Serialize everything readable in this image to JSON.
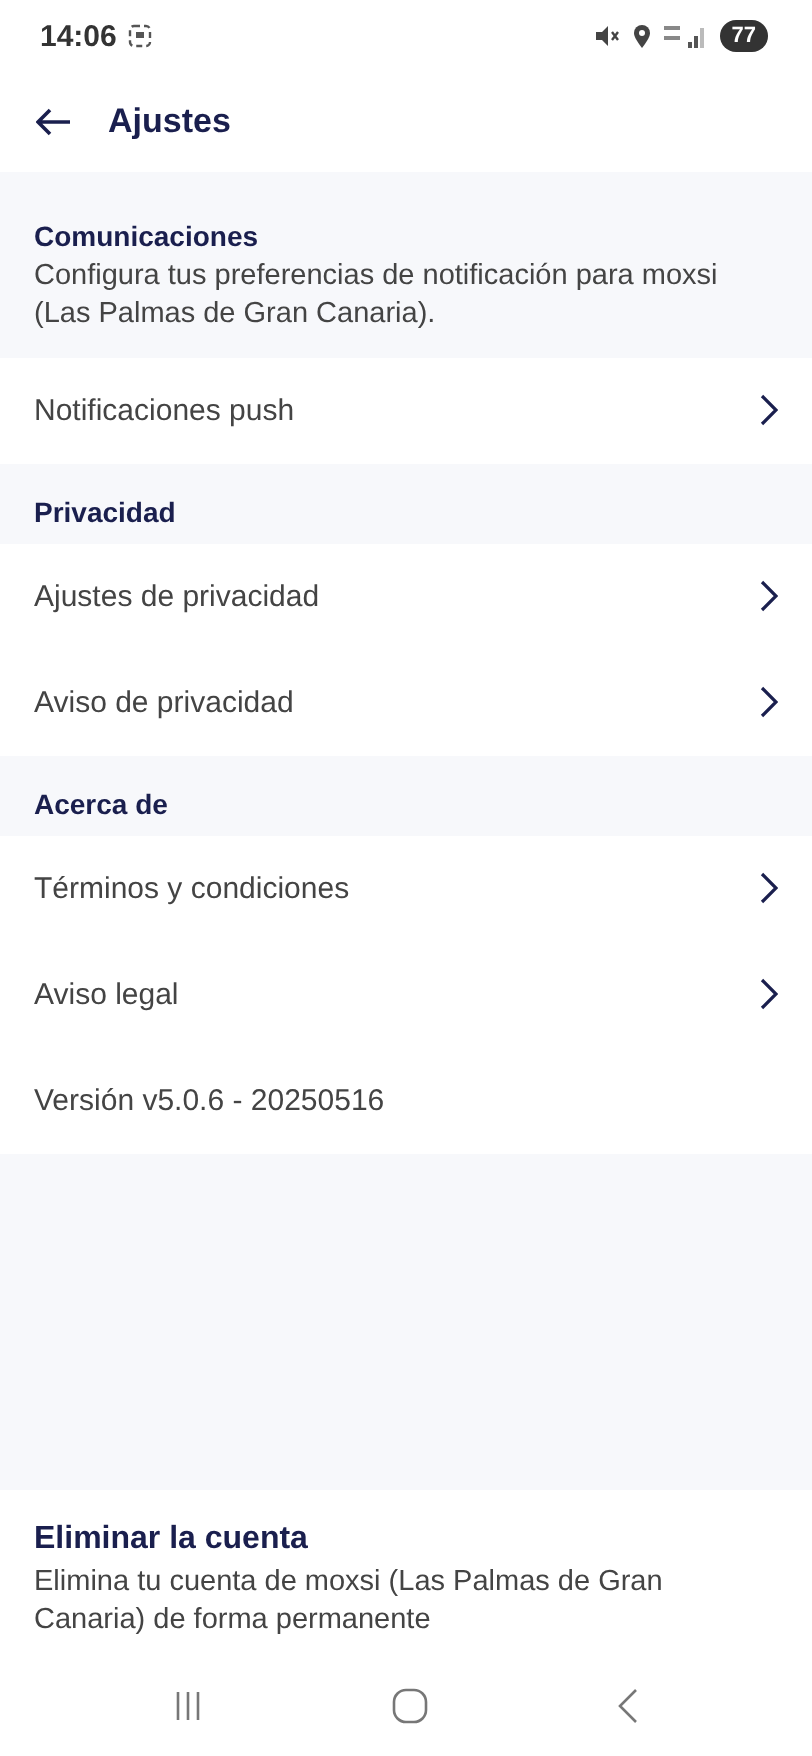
{
  "status_bar": {
    "time": "14:06",
    "battery": "77"
  },
  "header": {
    "title": "Ajustes"
  },
  "sections": [
    {
      "title": "Comunicaciones",
      "description": "Configura tus preferencias de notificación para moxsi (Las Palmas de Gran Canaria).",
      "items": [
        {
          "kind": "link",
          "label": "Notificaciones push"
        }
      ]
    },
    {
      "title": "Privacidad",
      "items": [
        {
          "kind": "link",
          "label": "Ajustes de privacidad"
        },
        {
          "kind": "link",
          "label": "Aviso de privacidad"
        }
      ]
    },
    {
      "title": "Acerca de",
      "items": [
        {
          "kind": "link",
          "label": "Términos y condiciones"
        },
        {
          "kind": "link",
          "label": "Aviso legal"
        },
        {
          "kind": "text",
          "label": "Versión v5.0.6 - 20250516"
        }
      ]
    }
  ],
  "delete_account": {
    "title": "Eliminar la cuenta",
    "description": "Elimina tu cuenta de moxsi (Las Palmas de Gran Canaria) de forma permanente"
  }
}
